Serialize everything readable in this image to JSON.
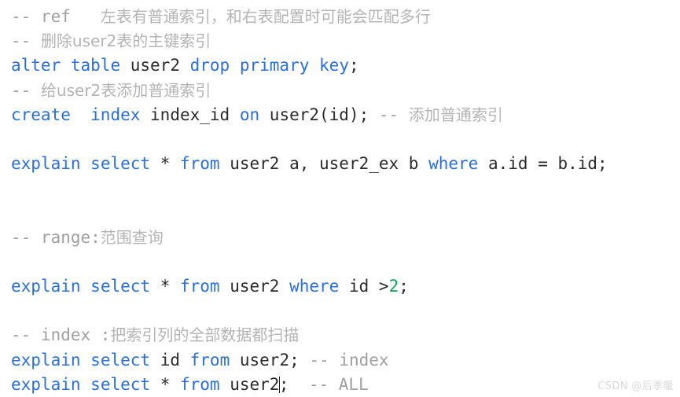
{
  "editor": {
    "background_color": "#ffffff",
    "font_size_px": 21,
    "line_height_px": 31,
    "caret_visible": true,
    "colors": {
      "keyword": "#2a6fdb",
      "identifier": "#2b2b2b",
      "number": "#14a05a",
      "comment": "#a0a0a0",
      "comment_cjk": "#b4b4b4",
      "caret": "#1a1a1a",
      "watermark": "#d8d8d8"
    }
  },
  "lines": [
    {
      "n": 1,
      "kind": "comment",
      "text": "-- ref   左表有普通索引，和右表配置时可能会匹配多行",
      "comment_ascii": "-- ref   ",
      "comment_cjk": "左表有普通索引，和右表配置时可能会匹配多行"
    },
    {
      "n": 2,
      "kind": "comment",
      "text": "-- 删除user2表的主键索引",
      "comment_ascii": "-- ",
      "comment_cjk": "删除user2表的主键索引"
    },
    {
      "n": 3,
      "kind": "code",
      "text": "alter table user2 drop primary key;",
      "tokens": [
        {
          "t": "alter",
          "c": "keyword"
        },
        {
          "t": " ",
          "c": "plain"
        },
        {
          "t": "table",
          "c": "keyword"
        },
        {
          "t": " ",
          "c": "plain"
        },
        {
          "t": "user2",
          "c": "identifier"
        },
        {
          "t": " ",
          "c": "plain"
        },
        {
          "t": "drop",
          "c": "keyword"
        },
        {
          "t": " ",
          "c": "plain"
        },
        {
          "t": "primary",
          "c": "keyword"
        },
        {
          "t": " ",
          "c": "plain"
        },
        {
          "t": "key",
          "c": "keyword"
        },
        {
          "t": ";",
          "c": "punct"
        }
      ]
    },
    {
      "n": 4,
      "kind": "comment",
      "text": "-- 给user2表添加普通索引",
      "comment_ascii": "-- ",
      "comment_cjk": "给user2表添加普通索引"
    },
    {
      "n": 5,
      "kind": "code",
      "text": "create  index index_id on user2(id); -- 添加普通索引",
      "tokens": [
        {
          "t": "create",
          "c": "keyword"
        },
        {
          "t": "  ",
          "c": "plain"
        },
        {
          "t": "index",
          "c": "keyword"
        },
        {
          "t": " ",
          "c": "plain"
        },
        {
          "t": "index_id",
          "c": "identifier"
        },
        {
          "t": " ",
          "c": "plain"
        },
        {
          "t": "on",
          "c": "keyword"
        },
        {
          "t": " ",
          "c": "plain"
        },
        {
          "t": "user2(id);",
          "c": "identifier"
        },
        {
          "t": " ",
          "c": "plain"
        },
        {
          "t": "-- ",
          "c": "comment"
        },
        {
          "t": "添加普通索引",
          "c": "comment_cjk"
        }
      ]
    },
    {
      "n": 6,
      "kind": "blank",
      "text": ""
    },
    {
      "n": 7,
      "kind": "code",
      "text": "explain select * from user2 a, user2_ex b where a.id = b.id;",
      "tokens": [
        {
          "t": "explain",
          "c": "keyword"
        },
        {
          "t": " ",
          "c": "plain"
        },
        {
          "t": "select",
          "c": "keyword"
        },
        {
          "t": " ",
          "c": "plain"
        },
        {
          "t": "*",
          "c": "identifier"
        },
        {
          "t": " ",
          "c": "plain"
        },
        {
          "t": "from",
          "c": "keyword"
        },
        {
          "t": " ",
          "c": "plain"
        },
        {
          "t": "user2 a, user2_ex b",
          "c": "identifier"
        },
        {
          "t": " ",
          "c": "plain"
        },
        {
          "t": "where",
          "c": "keyword"
        },
        {
          "t": " ",
          "c": "plain"
        },
        {
          "t": "a.id = b.id;",
          "c": "identifier"
        }
      ]
    },
    {
      "n": 8,
      "kind": "blank",
      "text": ""
    },
    {
      "n": 9,
      "kind": "blank",
      "text": ""
    },
    {
      "n": 10,
      "kind": "comment",
      "text": "-- range:范围查询",
      "comment_ascii": "-- range:",
      "comment_cjk": "范围查询"
    },
    {
      "n": 11,
      "kind": "blank",
      "text": ""
    },
    {
      "n": 12,
      "kind": "code",
      "text": "explain select * from user2 where id >2;",
      "tokens": [
        {
          "t": "explain",
          "c": "keyword"
        },
        {
          "t": " ",
          "c": "plain"
        },
        {
          "t": "select",
          "c": "keyword"
        },
        {
          "t": " ",
          "c": "plain"
        },
        {
          "t": "*",
          "c": "identifier"
        },
        {
          "t": " ",
          "c": "plain"
        },
        {
          "t": "from",
          "c": "keyword"
        },
        {
          "t": " ",
          "c": "plain"
        },
        {
          "t": "user2",
          "c": "identifier"
        },
        {
          "t": " ",
          "c": "plain"
        },
        {
          "t": "where",
          "c": "keyword"
        },
        {
          "t": " ",
          "c": "plain"
        },
        {
          "t": "id >",
          "c": "identifier"
        },
        {
          "t": "2",
          "c": "number"
        },
        {
          "t": ";",
          "c": "punct"
        }
      ]
    },
    {
      "n": 13,
      "kind": "blank",
      "text": ""
    },
    {
      "n": 14,
      "kind": "comment",
      "text": "-- index :把索引列的全部数据都扫描",
      "comment_ascii": "-- index :",
      "comment_cjk": "把索引列的全部数据都扫描"
    },
    {
      "n": 15,
      "kind": "code",
      "text": "explain select id from user2; -- index",
      "tokens": [
        {
          "t": "explain",
          "c": "keyword"
        },
        {
          "t": " ",
          "c": "plain"
        },
        {
          "t": "select",
          "c": "keyword"
        },
        {
          "t": " ",
          "c": "plain"
        },
        {
          "t": "id",
          "c": "identifier"
        },
        {
          "t": " ",
          "c": "plain"
        },
        {
          "t": "from",
          "c": "keyword"
        },
        {
          "t": " ",
          "c": "plain"
        },
        {
          "t": "user2;",
          "c": "identifier"
        },
        {
          "t": " ",
          "c": "plain"
        },
        {
          "t": "-- index",
          "c": "comment"
        }
      ]
    },
    {
      "n": 16,
      "kind": "code",
      "text": "explain select * from user2;  -- ALL",
      "caret_after": "user2",
      "tokens": [
        {
          "t": "explain",
          "c": "keyword"
        },
        {
          "t": " ",
          "c": "plain"
        },
        {
          "t": "select",
          "c": "keyword"
        },
        {
          "t": " ",
          "c": "plain"
        },
        {
          "t": "*",
          "c": "identifier"
        },
        {
          "t": " ",
          "c": "plain"
        },
        {
          "t": "from",
          "c": "keyword"
        },
        {
          "t": " ",
          "c": "plain"
        },
        {
          "t": "user2",
          "c": "identifier"
        },
        {
          "t": "CARET",
          "c": "caret"
        },
        {
          "t": ";",
          "c": "punct"
        },
        {
          "t": "  ",
          "c": "plain"
        },
        {
          "t": "-- ALL",
          "c": "comment"
        }
      ]
    }
  ],
  "watermark": {
    "text": "CSDN @后季暖"
  }
}
